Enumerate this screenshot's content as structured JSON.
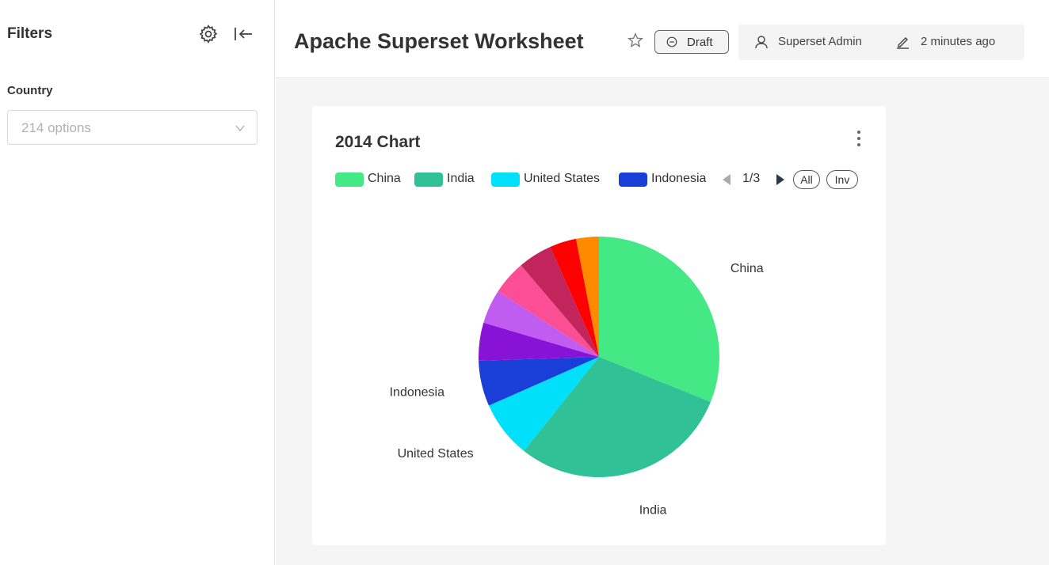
{
  "sidebar": {
    "title": "Filters",
    "filter": {
      "label": "Country",
      "placeholder": "214 options"
    }
  },
  "header": {
    "title": "Apache Superset Worksheet",
    "status": "Draft",
    "owner": "Superset Admin",
    "modified": "2 minutes ago"
  },
  "icons": {
    "gear": "gear-icon",
    "collapse": "collapse-sidebar-icon",
    "star": "star-icon",
    "draft": "minus-circle-icon",
    "user": "user-icon",
    "edit": "pencil-icon",
    "chevron": "chevron-down-icon",
    "kebab": "more-vertical-icon"
  },
  "chart": {
    "title": "2014 Chart",
    "legend_page": "1/3",
    "all_label": "All",
    "inv_label": "Inv"
  },
  "chart_data": {
    "type": "pie",
    "title": "2014 Chart",
    "legend_placement": "top",
    "legend_visible": [
      "China",
      "India",
      "United States",
      "Indonesia"
    ],
    "slices": [
      {
        "label": "China",
        "value": 30.5,
        "color": "#44e885",
        "show_label": true
      },
      {
        "label": "India",
        "value": 29.0,
        "color": "#30c196",
        "show_label": true
      },
      {
        "label": "United States",
        "value": 7.5,
        "color": "#00e0fb",
        "show_label": true
      },
      {
        "label": "Indonesia",
        "value": 6.0,
        "color": "#1a3fd8",
        "show_label": true
      },
      {
        "label": "",
        "value": 5.0,
        "color": "#8813d6",
        "show_label": false
      },
      {
        "label": "",
        "value": 4.5,
        "color": "#c15cf0",
        "show_label": false
      },
      {
        "label": "",
        "value": 4.5,
        "color": "#fb4e94",
        "show_label": false
      },
      {
        "label": "",
        "value": 4.5,
        "color": "#c2255c",
        "show_label": false
      },
      {
        "label": "",
        "value": 3.5,
        "color": "#ff0000",
        "show_label": false
      },
      {
        "label": "",
        "value": 3.0,
        "color": "#ff8a00",
        "show_label": false
      }
    ]
  }
}
